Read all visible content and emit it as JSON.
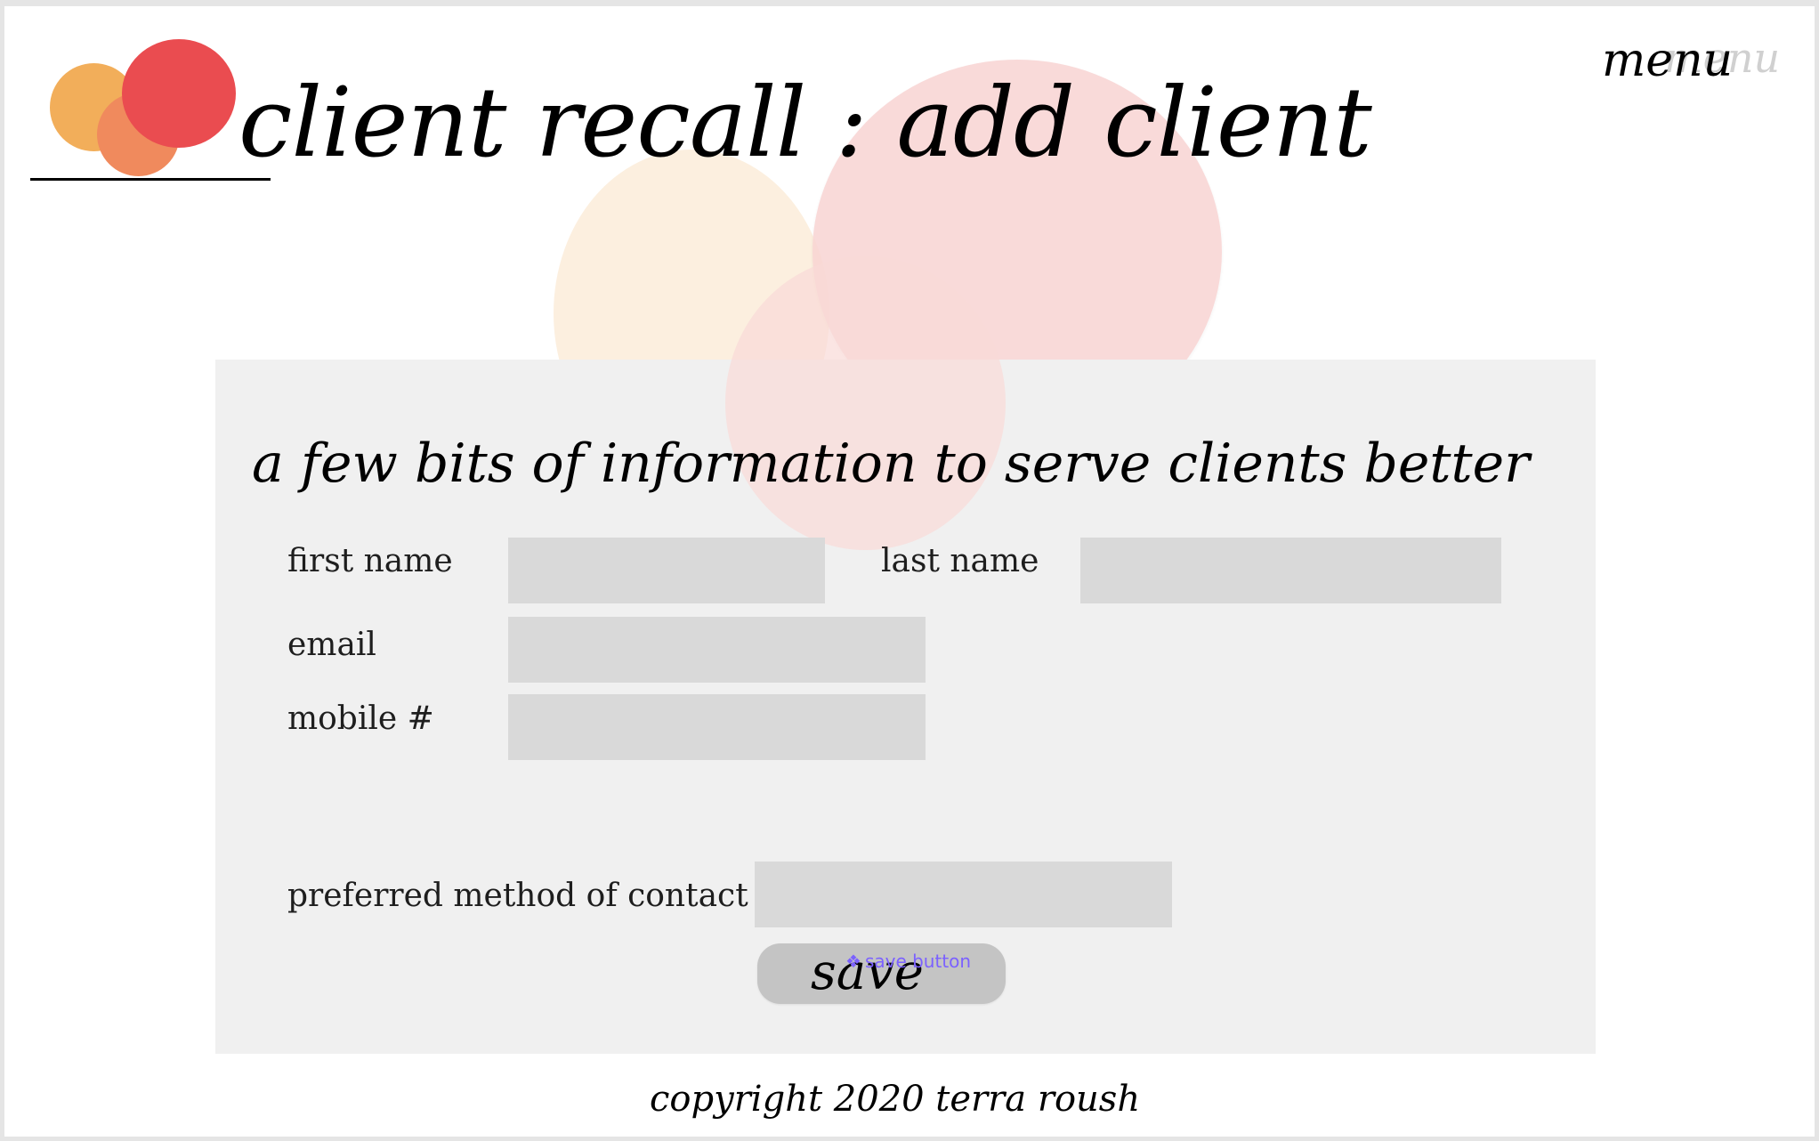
{
  "header": {
    "title": "client recall : add client",
    "menu_label": "menu",
    "menu_ghost": "menu"
  },
  "form": {
    "subtitle": "a few bits of information to serve clients better",
    "fields": {
      "first_name": {
        "label": "first name",
        "value": ""
      },
      "last_name": {
        "label": "last name",
        "value": ""
      },
      "email": {
        "label": "email",
        "value": ""
      },
      "mobile": {
        "label": "mobile #",
        "value": ""
      },
      "preferred_contact": {
        "label": "preferred method of contact",
        "value": ""
      }
    },
    "save_label": "save",
    "component_tag": "save button",
    "component_icon": "❖"
  },
  "footer": {
    "copyright": "copyright 2020 terra roush"
  },
  "colors": {
    "logo_orange": "#f2ae5a",
    "logo_coral": "#f08a5d",
    "logo_red": "#ea4c50",
    "panel_bg": "#f0f0f0",
    "field_bg": "#d9d9d9",
    "button_bg": "#c4c4c4",
    "component_tag": "#7b61ff"
  }
}
